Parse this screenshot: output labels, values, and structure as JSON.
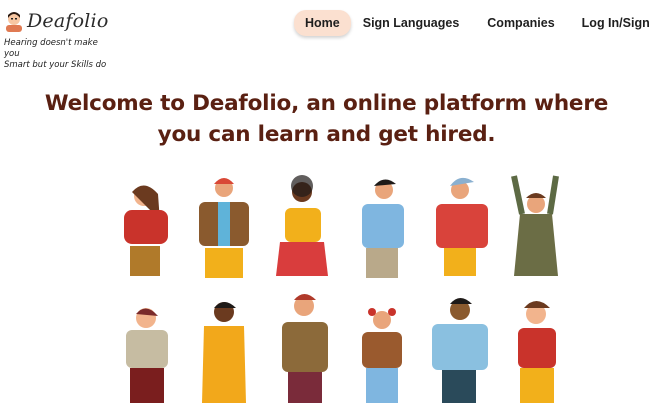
{
  "brand": {
    "name": "Deafolio",
    "tagline_line1": "Hearing doesn't make you",
    "tagline_line2": "Smart but your Skills do"
  },
  "nav": {
    "home": "Home",
    "sign_languages": "Sign Languages",
    "companies": "Companies",
    "login": "Log In/Sign Up"
  },
  "hero": {
    "line1": "Welcome to Deafolio, an online platform where",
    "line2": "you can  learn and get hired."
  },
  "colors": {
    "accent": "#5a2012",
    "nav_active_bg": "#fbe0d0"
  },
  "illustration": {
    "description_icons": [
      "person-signing-icon"
    ]
  }
}
